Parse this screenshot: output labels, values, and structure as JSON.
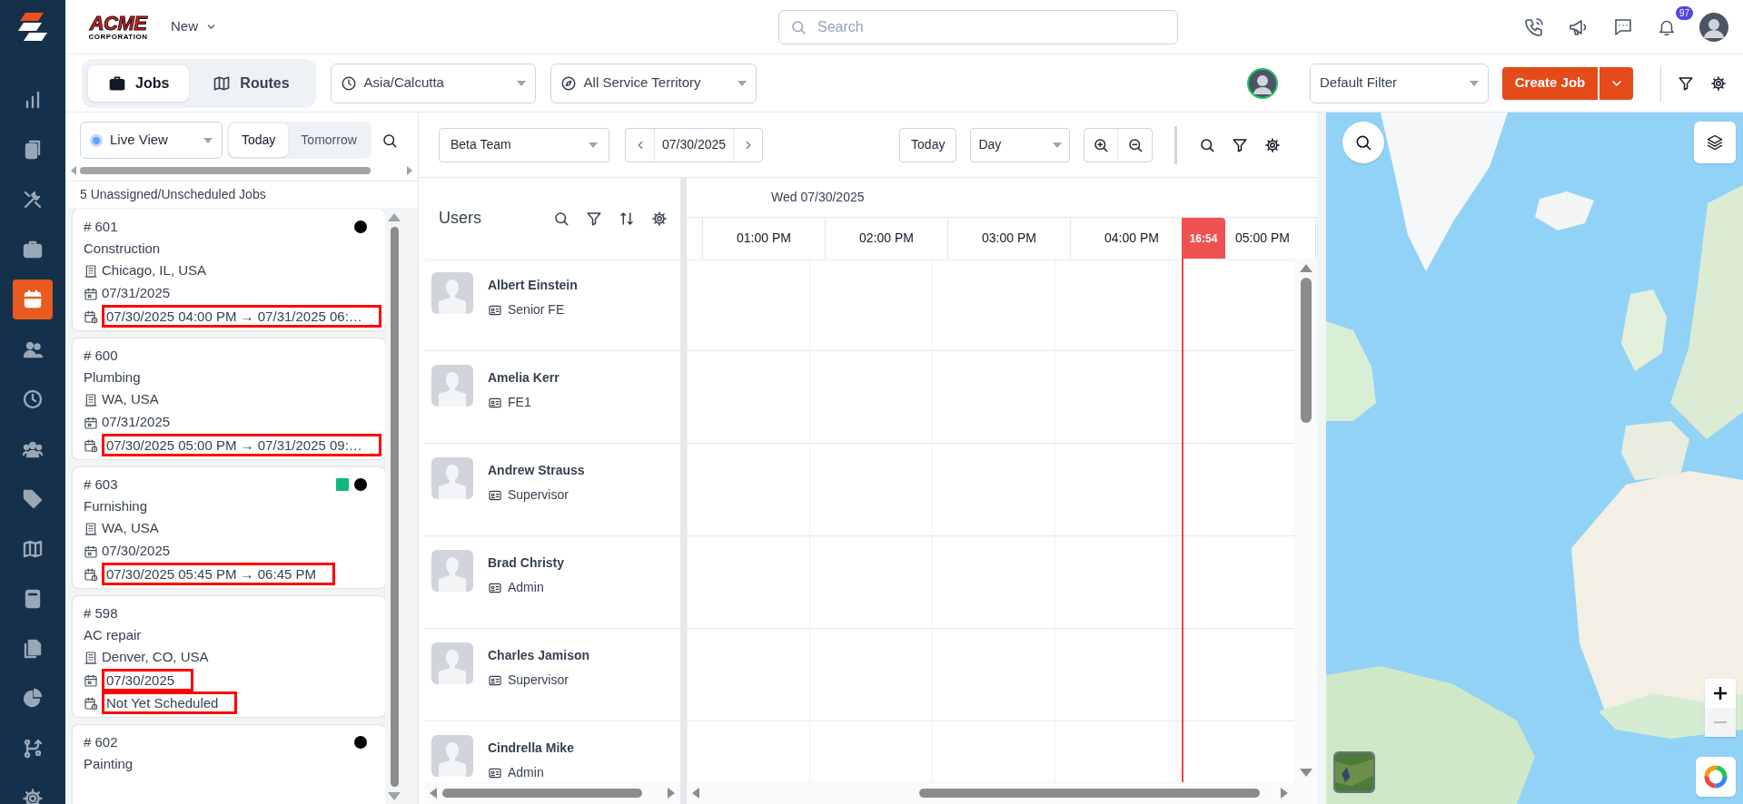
{
  "sidebar": {
    "items": [
      {
        "kind": "chart",
        "selected": false
      },
      {
        "kind": "clipboard",
        "selected": false
      },
      {
        "kind": "tools",
        "selected": false
      },
      {
        "kind": "briefcase",
        "selected": false
      },
      {
        "kind": "calendar",
        "selected": true
      },
      {
        "kind": "users",
        "selected": false
      },
      {
        "kind": "clock",
        "selected": false
      },
      {
        "kind": "group",
        "selected": false
      },
      {
        "kind": "tag",
        "selected": false
      },
      {
        "kind": "map",
        "selected": false
      },
      {
        "kind": "calculator",
        "selected": false
      },
      {
        "kind": "files",
        "selected": false
      },
      {
        "kind": "pie",
        "selected": false
      },
      {
        "kind": "branch",
        "selected": false
      },
      {
        "kind": "gear",
        "selected": false
      }
    ]
  },
  "header": {
    "logo_text": "ACME",
    "logo_subtext": "CORPORATION",
    "new_menu": "New",
    "search": {
      "placeholder": "Search"
    },
    "notification_count": "97"
  },
  "toolbar": {
    "tabs": [
      {
        "label": "Jobs",
        "kind": "briefcase",
        "selected": true
      },
      {
        "label": "Routes",
        "kind": "map",
        "selected": false
      }
    ],
    "timezone": "Asia/Calcutta",
    "territory": "All Service Territory",
    "filter": "Default Filter",
    "create_button": "Create Job"
  },
  "jobs_panel": {
    "view": "Live View",
    "days": [
      {
        "label": "Today",
        "selected": true
      },
      {
        "label": "Tomorrow",
        "selected": false
      }
    ],
    "count_label": "5 Unassigned/Unscheduled Jobs",
    "jobs": [
      {
        "number": "# 601",
        "title": "Construction",
        "markers": [
          {
            "kind": "dot",
            "color": "#000000"
          }
        ],
        "lines": [
          {
            "kind": "address",
            "text": "Chicago, IL, USA",
            "highlighted": false
          },
          {
            "kind": "date",
            "text": "07/31/2025",
            "highlighted": false
          },
          {
            "kind": "schedule",
            "text": "07/30/2025 04:00 PM → 07/31/2025 06:…",
            "highlighted": true
          }
        ]
      },
      {
        "number": "# 600",
        "title": "Plumbing",
        "lines": [
          {
            "kind": "address",
            "text": "WA, USA",
            "highlighted": false
          },
          {
            "kind": "date",
            "text": "07/31/2025",
            "highlighted": false
          },
          {
            "kind": "schedule",
            "text": "07/30/2025 05:00 PM → 07/31/2025 09:…",
            "highlighted": true
          }
        ]
      },
      {
        "number": "# 603",
        "title": "Furnishing",
        "markers": [
          {
            "kind": "square",
            "color": "#10b981"
          },
          {
            "kind": "dot",
            "color": "#000000"
          }
        ],
        "lines": [
          {
            "kind": "address",
            "text": "WA, USA",
            "highlighted": false
          },
          {
            "kind": "date",
            "text": "07/30/2025",
            "highlighted": false
          },
          {
            "kind": "schedule",
            "text": "07/30/2025 05:45 PM → 06:45 PM",
            "highlighted": true
          }
        ]
      },
      {
        "number": "# 598",
        "title": "AC repair",
        "lines": [
          {
            "kind": "address",
            "text": "Denver, CO, USA",
            "highlighted": false
          },
          {
            "kind": "date",
            "text": "07/30/2025",
            "highlighted": true
          },
          {
            "kind": "schedule",
            "text": "Not Yet Scheduled",
            "highlighted": true
          }
        ]
      },
      {
        "number": "# 602",
        "title": "Painting",
        "markers": [
          {
            "kind": "dot",
            "color": "#000000"
          }
        ]
      }
    ]
  },
  "scheduler": {
    "team": "Beta Team",
    "date": "07/30/2025",
    "today_button": "Today",
    "view": "Day",
    "users_title": "Users",
    "day_label": "Wed 07/30/2025",
    "hours": [
      "01:00 PM",
      "02:00 PM",
      "03:00 PM",
      "04:00 PM",
      "05:00 PM"
    ],
    "now": "16:54",
    "users": [
      {
        "name": "Albert Einstein",
        "role": "Senior FE"
      },
      {
        "name": "Amelia Kerr",
        "role": "FE1"
      },
      {
        "name": "Andrew Strauss",
        "role": "Supervisor"
      },
      {
        "name": "Brad Christy",
        "role": "Admin"
      },
      {
        "name": "Charles Jamison",
        "role": "Supervisor"
      },
      {
        "name": "Cindrella Mike",
        "role": "Admin"
      }
    ]
  }
}
